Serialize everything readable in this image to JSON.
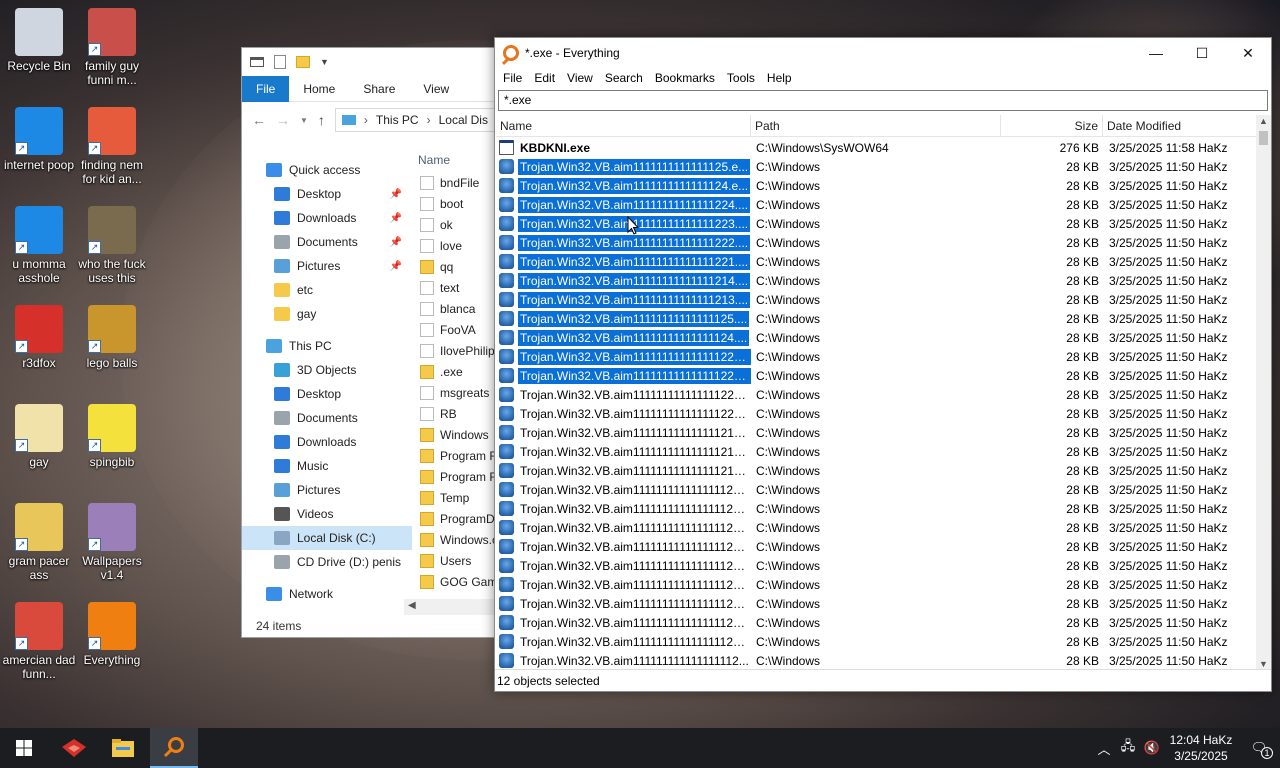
{
  "desktop": {
    "icons": [
      {
        "label": "Recycle Bin",
        "icon": "recycle-bin-icon",
        "color": "#cfd6df"
      },
      {
        "label": "family guy funni m...",
        "icon": "cartoon-shortcut-icon",
        "color": "#c9504a"
      },
      {
        "label": "internet poop",
        "icon": "internet-explorer-icon",
        "color": "#1e88e5"
      },
      {
        "label": "finding nem for kid an...",
        "icon": "fish-icon",
        "color": "#e55b3c"
      },
      {
        "label": "u momma asshole",
        "icon": "internet-explorer-icon",
        "color": "#1e88e5"
      },
      {
        "label": "who the fuck uses this",
        "icon": "gimp-icon",
        "color": "#7a6a4e"
      },
      {
        "label": "r3dfox",
        "icon": "redfox-icon",
        "color": "#d6302a"
      },
      {
        "label": "lego balls",
        "icon": "lego-figure-icon",
        "color": "#c9962e"
      },
      {
        "label": "gay",
        "icon": "document-icon",
        "color": "#f0e2a8"
      },
      {
        "label": "spingbib",
        "icon": "spongebob-icon",
        "color": "#f4e13b"
      },
      {
        "label": "gram pacer ass",
        "icon": "folder-icon",
        "color": "#e8c65a"
      },
      {
        "label": "Wallpapers v1.4",
        "icon": "wallpapers-icon",
        "color": "#9b7fb8"
      },
      {
        "label": "amercian dad funn...",
        "icon": "cartoon-face-icon",
        "color": "#d94a3c"
      },
      {
        "label": "Everything",
        "icon": "everything-icon",
        "color": "#f07f12"
      }
    ]
  },
  "explorer": {
    "tabs": [
      "File",
      "Home",
      "Share",
      "View"
    ],
    "breadcrumb": [
      "This PC",
      "Local Dis"
    ],
    "nav": [
      {
        "label": "Quick access",
        "icon": "star-icon",
        "pinned": false,
        "indent": 1,
        "color": "#3b8ee8"
      },
      {
        "label": "Desktop",
        "icon": "desktop-icon",
        "pinned": true,
        "indent": 2,
        "color": "#2f7cd8"
      },
      {
        "label": "Downloads",
        "icon": "download-icon",
        "pinned": true,
        "indent": 2,
        "color": "#2f7cd8"
      },
      {
        "label": "Documents",
        "icon": "documents-icon",
        "pinned": true,
        "indent": 2,
        "color": "#9aa4ad"
      },
      {
        "label": "Pictures",
        "icon": "pictures-icon",
        "pinned": true,
        "indent": 2,
        "color": "#5aa0d8"
      },
      {
        "label": "etc",
        "icon": "folder-icon",
        "pinned": false,
        "indent": 2,
        "color": "#f5c94a"
      },
      {
        "label": "gay",
        "icon": "folder-icon",
        "pinned": false,
        "indent": 2,
        "color": "#f5c94a"
      },
      {
        "label": "This PC",
        "icon": "computer-icon",
        "pinned": false,
        "indent": 1,
        "color": "#4aa3df"
      },
      {
        "label": "3D Objects",
        "icon": "cube-icon",
        "pinned": false,
        "indent": 2,
        "color": "#39a0d8"
      },
      {
        "label": "Desktop",
        "icon": "desktop-icon",
        "pinned": false,
        "indent": 2,
        "color": "#2f7cd8"
      },
      {
        "label": "Documents",
        "icon": "documents-icon",
        "pinned": false,
        "indent": 2,
        "color": "#9aa4ad"
      },
      {
        "label": "Downloads",
        "icon": "download-icon",
        "pinned": false,
        "indent": 2,
        "color": "#2f7cd8"
      },
      {
        "label": "Music",
        "icon": "music-icon",
        "pinned": false,
        "indent": 2,
        "color": "#2f7cd8"
      },
      {
        "label": "Pictures",
        "icon": "pictures-icon",
        "pinned": false,
        "indent": 2,
        "color": "#5aa0d8"
      },
      {
        "label": "Videos",
        "icon": "videos-icon",
        "pinned": false,
        "indent": 2,
        "color": "#555"
      },
      {
        "label": "Local Disk (C:)",
        "icon": "drive-icon",
        "pinned": false,
        "indent": 2,
        "color": "#8aa6c2",
        "selected": true
      },
      {
        "label": "CD Drive (D:) penis",
        "icon": "cd-drive-icon",
        "pinned": false,
        "indent": 2,
        "color": "#9aa4ad"
      },
      {
        "label": "Network",
        "icon": "network-icon",
        "pinned": false,
        "indent": 1,
        "color": "#3b8ee8"
      }
    ],
    "column_name": "Name",
    "files": [
      {
        "name": "bndFile",
        "folder": false
      },
      {
        "name": "boot",
        "folder": false
      },
      {
        "name": "ok",
        "folder": false
      },
      {
        "name": "love",
        "folder": false
      },
      {
        "name": "qq",
        "folder": true
      },
      {
        "name": "text",
        "folder": false
      },
      {
        "name": "blanca",
        "folder": false
      },
      {
        "name": "FooVA",
        "folder": false
      },
      {
        "name": "IlovePhilip",
        "folder": false
      },
      {
        "name": ".exe",
        "folder": true
      },
      {
        "name": "msgreats",
        "folder": false
      },
      {
        "name": "RB",
        "folder": false
      },
      {
        "name": "Windows",
        "folder": true
      },
      {
        "name": "Program F",
        "folder": true
      },
      {
        "name": "Program F",
        "folder": true
      },
      {
        "name": "Temp",
        "folder": true
      },
      {
        "name": "ProgramD",
        "folder": true
      },
      {
        "name": "Windows.c",
        "folder": true
      },
      {
        "name": "Users",
        "folder": true
      },
      {
        "name": "GOG Gam",
        "folder": true
      }
    ],
    "status": "24 items"
  },
  "everything": {
    "title": "*.exe - Everything",
    "menu": [
      "File",
      "Edit",
      "View",
      "Search",
      "Bookmarks",
      "Tools",
      "Help"
    ],
    "search_value": "*.exe",
    "columns": {
      "name": "Name",
      "path": "Path",
      "size": "Size",
      "date": "Date Modified"
    },
    "rows": [
      {
        "name": "KBDKNI.exe",
        "path": "C:\\Windows\\SysWOW64",
        "size": "276 KB",
        "date": "3/25/2025 11:58 HaKz",
        "selected": false,
        "bold": true,
        "icon": "window-app-icon"
      },
      {
        "name": "Trojan.Win32.VB.aim1111111111111125.e...",
        "path": "C:\\Windows",
        "size": "28 KB",
        "date": "3/25/2025 11:50 HaKz",
        "selected": true
      },
      {
        "name": "Trojan.Win32.VB.aim1111111111111124.e...",
        "path": "C:\\Windows",
        "size": "28 KB",
        "date": "3/25/2025 11:50 HaKz",
        "selected": true
      },
      {
        "name": "Trojan.Win32.VB.aim11111111111111224....",
        "path": "C:\\Windows",
        "size": "28 KB",
        "date": "3/25/2025 11:50 HaKz",
        "selected": true
      },
      {
        "name": "Trojan.Win32.VB.aim11111111111111223....",
        "path": "C:\\Windows",
        "size": "28 KB",
        "date": "3/25/2025 11:50 HaKz",
        "selected": true
      },
      {
        "name": "Trojan.Win32.VB.aim11111111111111222....",
        "path": "C:\\Windows",
        "size": "28 KB",
        "date": "3/25/2025 11:50 HaKz",
        "selected": true
      },
      {
        "name": "Trojan.Win32.VB.aim11111111111111221....",
        "path": "C:\\Windows",
        "size": "28 KB",
        "date": "3/25/2025 11:50 HaKz",
        "selected": true
      },
      {
        "name": "Trojan.Win32.VB.aim11111111111111214....",
        "path": "C:\\Windows",
        "size": "28 KB",
        "date": "3/25/2025 11:50 HaKz",
        "selected": true
      },
      {
        "name": "Trojan.Win32.VB.aim11111111111111213....",
        "path": "C:\\Windows",
        "size": "28 KB",
        "date": "3/25/2025 11:50 HaKz",
        "selected": true
      },
      {
        "name": "Trojan.Win32.VB.aim11111111111111125....",
        "path": "C:\\Windows",
        "size": "28 KB",
        "date": "3/25/2025 11:50 HaKz",
        "selected": true
      },
      {
        "name": "Trojan.Win32.VB.aim11111111111111124....",
        "path": "C:\\Windows",
        "size": "28 KB",
        "date": "3/25/2025 11:50 HaKz",
        "selected": true
      },
      {
        "name": "Trojan.Win32.VB.aim111111111111111224...",
        "path": "C:\\Windows",
        "size": "28 KB",
        "date": "3/25/2025 11:50 HaKz",
        "selected": true
      },
      {
        "name": "Trojan.Win32.VB.aim111111111111111223...",
        "path": "C:\\Windows",
        "size": "28 KB",
        "date": "3/25/2025 11:50 HaKz",
        "selected": true
      },
      {
        "name": "Trojan.Win32.VB.aim111111111111111222...",
        "path": "C:\\Windows",
        "size": "28 KB",
        "date": "3/25/2025 11:50 HaKz",
        "selected": false
      },
      {
        "name": "Trojan.Win32.VB.aim111111111111111221...",
        "path": "C:\\Windows",
        "size": "28 KB",
        "date": "3/25/2025 11:50 HaKz",
        "selected": false
      },
      {
        "name": "Trojan.Win32.VB.aim111111111111111215...",
        "path": "C:\\Windows",
        "size": "28 KB",
        "date": "3/25/2025 11:50 HaKz",
        "selected": false
      },
      {
        "name": "Trojan.Win32.VB.aim111111111111111214...",
        "path": "C:\\Windows",
        "size": "28 KB",
        "date": "3/25/2025 11:50 HaKz",
        "selected": false
      },
      {
        "name": "Trojan.Win32.VB.aim111111111111111213...",
        "path": "C:\\Windows",
        "size": "28 KB",
        "date": "3/25/2025 11:50 HaKz",
        "selected": false
      },
      {
        "name": "Trojan.Win32.VB.aim111111111111111125...",
        "path": "C:\\Windows",
        "size": "28 KB",
        "date": "3/25/2025 11:50 HaKz",
        "selected": false
      },
      {
        "name": "Trojan.Win32.VB.aim111111111111111124...",
        "path": "C:\\Windows",
        "size": "28 KB",
        "date": "3/25/2025 11:50 HaKz",
        "selected": false
      },
      {
        "name": "Trojan.Win32.VB.aim111111111111111122...",
        "path": "C:\\Windows",
        "size": "28 KB",
        "date": "3/25/2025 11:50 HaKz",
        "selected": false
      },
      {
        "name": "Trojan.Win32.VB.aim111111111111111122...",
        "path": "C:\\Windows",
        "size": "28 KB",
        "date": "3/25/2025 11:50 HaKz",
        "selected": false
      },
      {
        "name": "Trojan.Win32.VB.aim111111111111111122...",
        "path": "C:\\Windows",
        "size": "28 KB",
        "date": "3/25/2025 11:50 HaKz",
        "selected": false
      },
      {
        "name": "Trojan.Win32.VB.aim111111111111111122...",
        "path": "C:\\Windows",
        "size": "28 KB",
        "date": "3/25/2025 11:50 HaKz",
        "selected": false
      },
      {
        "name": "Trojan.Win32.VB.aim111111111111111121...",
        "path": "C:\\Windows",
        "size": "28 KB",
        "date": "3/25/2025 11:50 HaKz",
        "selected": false
      },
      {
        "name": "Trojan.Win32.VB.aim111111111111111121...",
        "path": "C:\\Windows",
        "size": "28 KB",
        "date": "3/25/2025 11:50 HaKz",
        "selected": false
      },
      {
        "name": "Trojan.Win32.VB.aim111111111111111121...",
        "path": "C:\\Windows",
        "size": "28 KB",
        "date": "3/25/2025 11:50 HaKz",
        "selected": false
      },
      {
        "name": "Trojan.Win32.VB.aim111111111111111112...",
        "path": "C:\\Windows",
        "size": "28 KB",
        "date": "3/25/2025 11:50 HaKz",
        "selected": false
      }
    ],
    "status": "12 objects selected"
  },
  "taskbar": {
    "apps": [
      {
        "icon": "windows-start-icon"
      },
      {
        "icon": "redfox-icon"
      },
      {
        "icon": "file-explorer-icon"
      },
      {
        "icon": "everything-icon",
        "active": true
      }
    ],
    "tray": [
      "chevron-up-icon",
      "network-icon",
      "volume-muted-icon"
    ],
    "time": "12:04 HaKz",
    "date": "3/25/2025",
    "notifications": "1",
    "accent": "#76b9ed",
    "selection_color": "#0a6fd6"
  }
}
